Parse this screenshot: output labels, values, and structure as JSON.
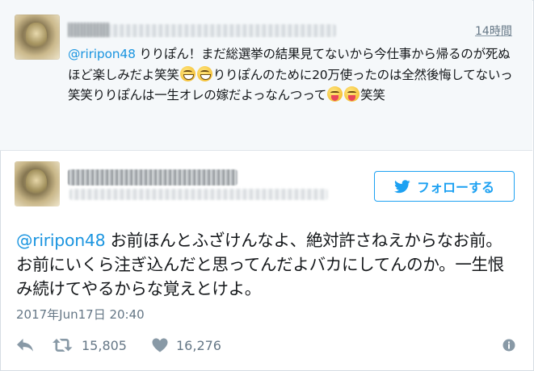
{
  "reply_tweet": {
    "timestamp": "14時間",
    "mention": "@riripon48",
    "text": " りりぽん！まだ総選挙の結果見てないから今仕事から帰るのが死ぬほど楽しみだよ笑笑",
    "text_after_emoji1": "りりぽんのために20万使ったのは全然後悔してないっ笑笑りりぽんは一生オレの嫁だよっなんつって",
    "text_after_emoji2": "笑笑",
    "emoji1": "grinning-face",
    "emoji2": "face-with-tongue"
  },
  "main_tweet": {
    "follow_button_label": "フォローする",
    "mention": "@riripon48",
    "text": " お前ほんとふざけんなよ、絶対許さねえからなお前。お前にいくら注ぎ込んだと思ってんだよバカにしてんのか。一生恨み続けてやるからな覚えとけよ。",
    "date": "2017年Jun17日 20:40",
    "retweet_count": "15,805",
    "like_count": "16,276"
  },
  "colors": {
    "accent": "#1da1f2",
    "mention": "#1b95e0",
    "muted": "#657786",
    "reply_bg": "#f5f8fa"
  }
}
